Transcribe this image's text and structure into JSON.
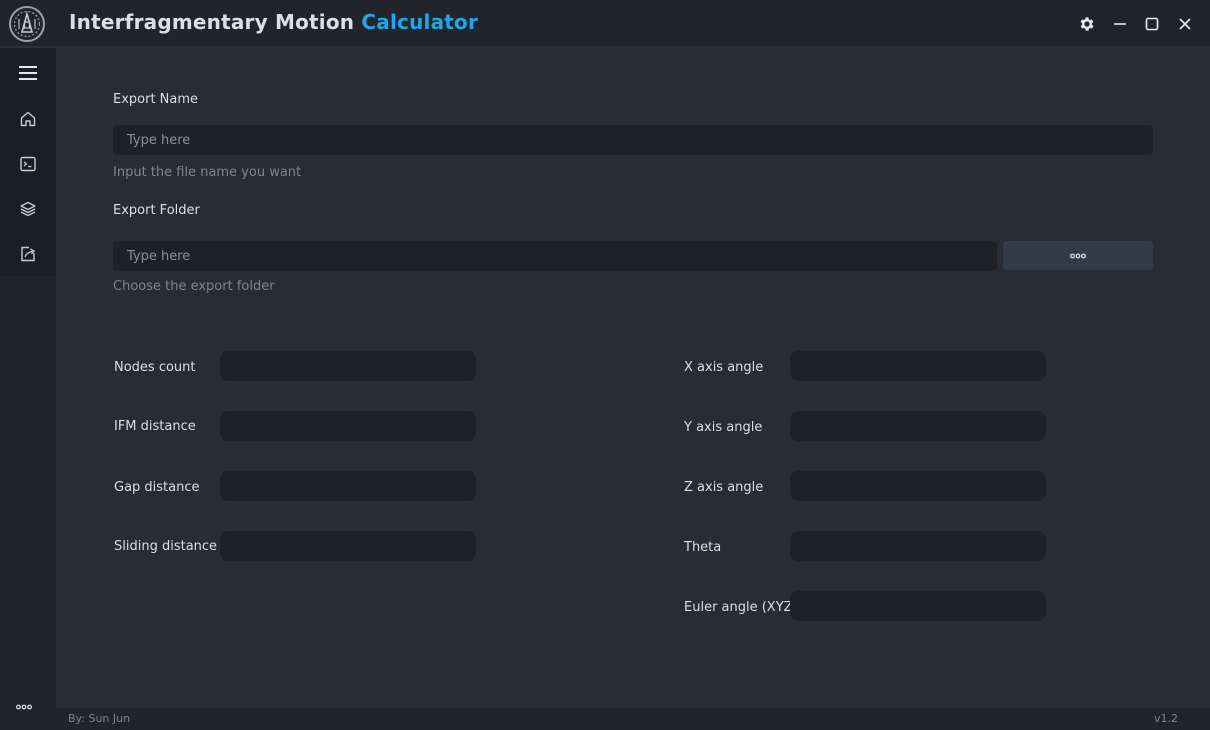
{
  "window": {
    "title_main": "Interfragmentary Motion ",
    "title_accent": "Calculator",
    "accent_color": "#1aa7ec",
    "controls": [
      "settings-icon",
      "minimize-icon",
      "maximize-icon",
      "close-icon"
    ]
  },
  "sidebar": {
    "items": [
      "menu-icon",
      "home-icon",
      "terminal-icon",
      "layers-icon",
      "export-icon"
    ],
    "more": "more-icon"
  },
  "export_name": {
    "label": "Export Name",
    "placeholder": "Type here",
    "hint": "Input the file name you want"
  },
  "export_folder": {
    "label": "Export Folder",
    "placeholder": "Type here",
    "hint": "Choose the export folder",
    "browse_button": "more-icon"
  },
  "left_fields": [
    {
      "label": "Nodes count",
      "value": ""
    },
    {
      "label": "IFM distance",
      "value": ""
    },
    {
      "label": "Gap distance",
      "value": ""
    },
    {
      "label": "Sliding distance",
      "value": ""
    }
  ],
  "right_fields": [
    {
      "label": "X axis angle",
      "value": ""
    },
    {
      "label": "Y axis angle",
      "value": ""
    },
    {
      "label": "Z axis angle",
      "value": ""
    },
    {
      "label": "Theta",
      "value": ""
    },
    {
      "label": "Euler angle (XYZ)",
      "value": ""
    }
  ],
  "footer": {
    "credit": "By: Sun Jun",
    "version": "v1.2"
  }
}
